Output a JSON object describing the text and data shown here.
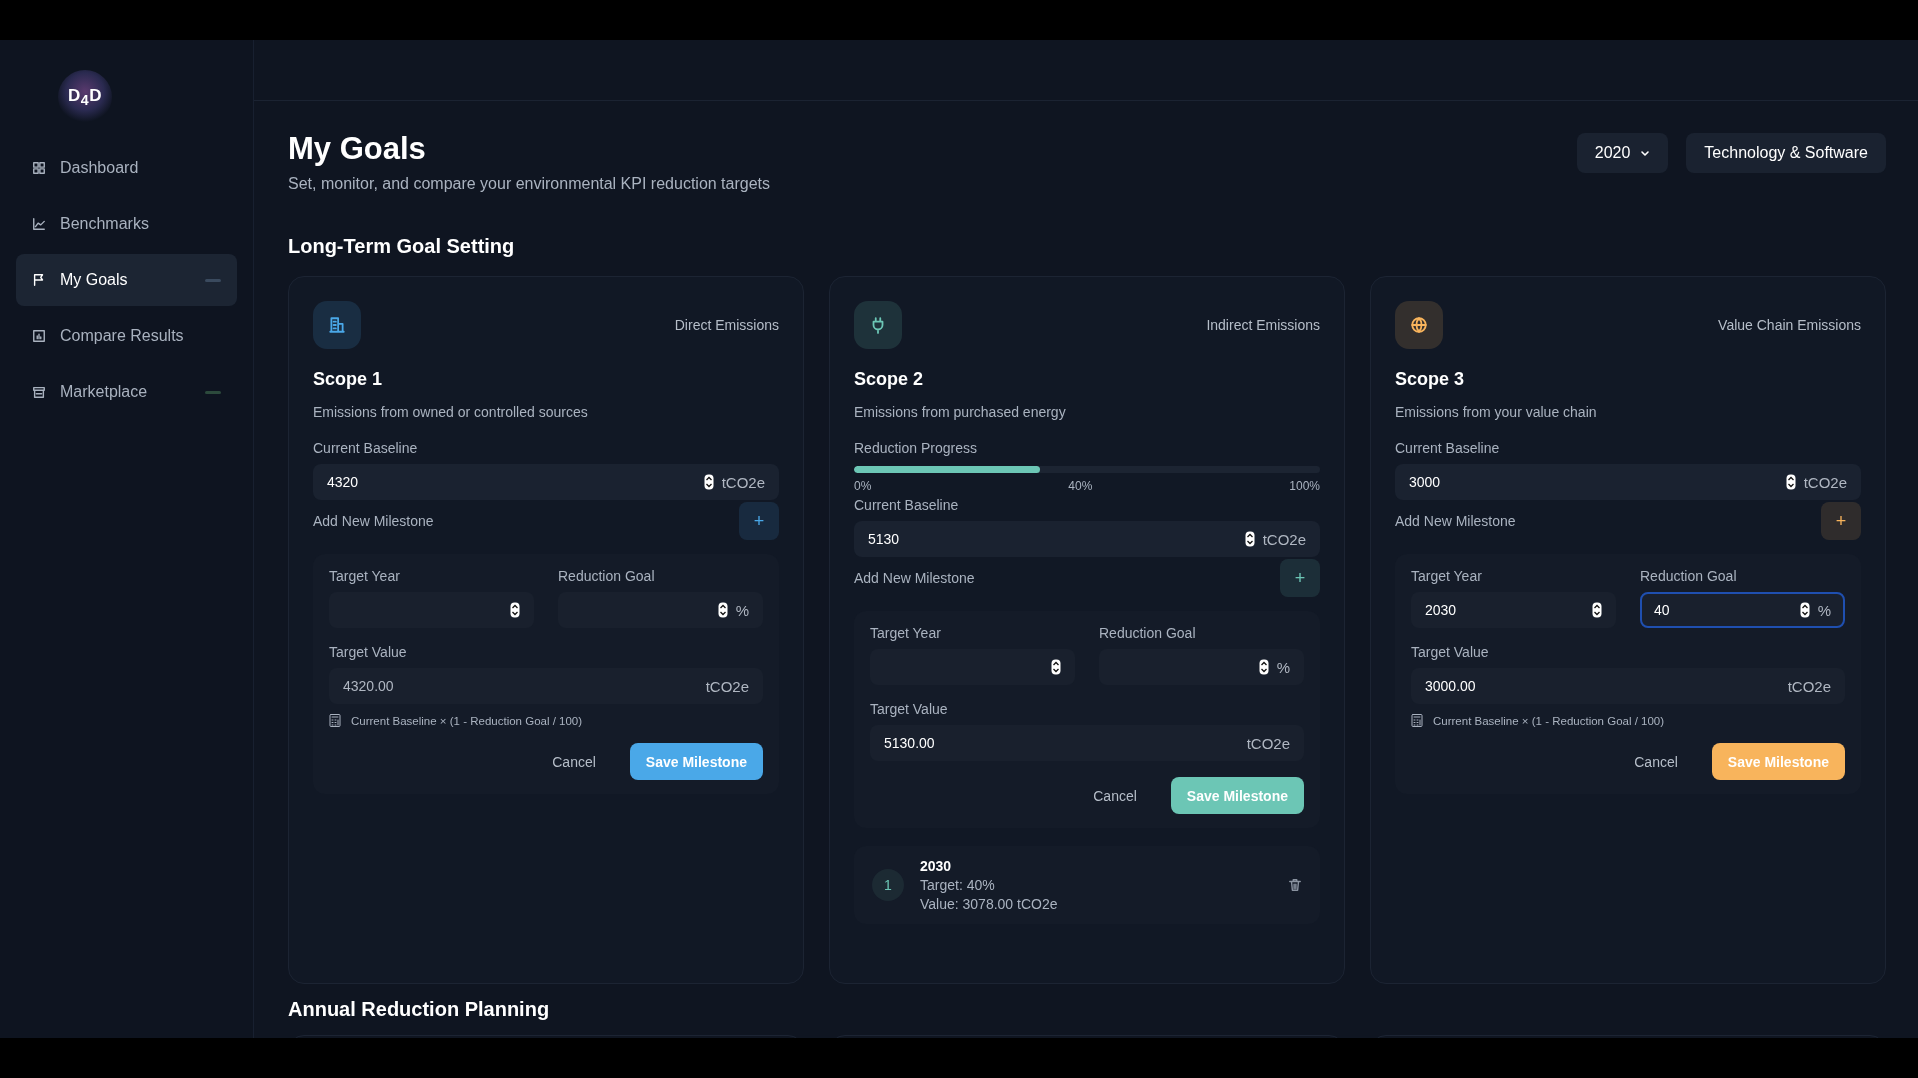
{
  "sidebar": {
    "logo": "D$_{4}$D",
    "items": [
      {
        "label": "Dashboard",
        "selected": false
      },
      {
        "label": "Benchmarks",
        "selected": false
      },
      {
        "label": "My Goals",
        "selected": true,
        "color": "#3a4a5e"
      },
      {
        "label": "Compare Results",
        "selected": false
      },
      {
        "label": "Marketplace",
        "selected": false,
        "color": "#2c4a3c"
      }
    ]
  },
  "header": {
    "title": "My Goals",
    "subtitle": "Set, monitor, and compare your environmental KPI reduction targets",
    "year": "2020",
    "industry": "Technology & Software"
  },
  "long_term": {
    "title": "Long-Term Goal Setting",
    "scopes": [
      {
        "color": "#4aa8e8",
        "category": "Direct Emissions",
        "title": "Scope 1",
        "description": "Emissions from owned or controlled sources",
        "baseline_label": "Current Baseline",
        "baseline": "4320",
        "unit": "tCO2e",
        "add_label": "Add New Milestone",
        "add_button": "+",
        "form": {
          "year_label": "Target Year",
          "goal_label": "Reduction Goal",
          "percent": "%",
          "goal_focused": false,
          "value_label": "Target Value",
          "value": "4320.00",
          "value_dim": true,
          "unit": "tCO2e",
          "formula": "Current Baseline × (1 - Reduction Goal / 100)",
          "cancel": "Cancel",
          "save": "Save Milestone"
        }
      },
      {
        "color": "#6cc6b5",
        "category": "Indirect Emissions",
        "title": "Scope 2",
        "description": "Emissions from purchased energy",
        "progress": {
          "label": "Reduction Progress",
          "level": 0.4,
          "ticks": [
            "0%",
            "40%",
            "100%"
          ]
        },
        "baseline_label": "Current Baseline",
        "baseline": "5130",
        "unit": "tCO2e",
        "add_label": "Add New Milestone",
        "add_button": "+",
        "form": {
          "year_label": "Target Year",
          "goal_label": "Reduction Goal",
          "percent": "%",
          "goal_focused": false,
          "value_label": "Target Value",
          "value": "5130.00",
          "value_dim": false,
          "unit": "tCO2e",
          "cancel": "Cancel",
          "save": "Save Milestone"
        },
        "milestones": [
          {
            "number": "1",
            "year": "2030",
            "target": "Target: 40%",
            "value": "Value: 3078.00 tCO2e"
          }
        ]
      },
      {
        "color": "#f8b45c",
        "category": "Value Chain Emissions",
        "title": "Scope 3",
        "description": "Emissions from your value chain",
        "baseline_label": "Current Baseline",
        "baseline": "3000",
        "unit": "tCO2e",
        "add_label": "Add New Milestone",
        "add_button": "+",
        "form": {
          "year_label": "Target Year",
          "year": "2030",
          "goal_label": "Reduction Goal",
          "goal": "40",
          "percent": "%",
          "goal_focused": true,
          "value_label": "Target Value",
          "value": "3000.00",
          "value_dim": false,
          "unit": "tCO2e",
          "formula": "Current Baseline × (1 - Reduction Goal / 100)",
          "cancel": "Cancel",
          "save": "Save Milestone"
        }
      }
    ]
  },
  "annual": {
    "title": "Annual Reduction Planning"
  }
}
